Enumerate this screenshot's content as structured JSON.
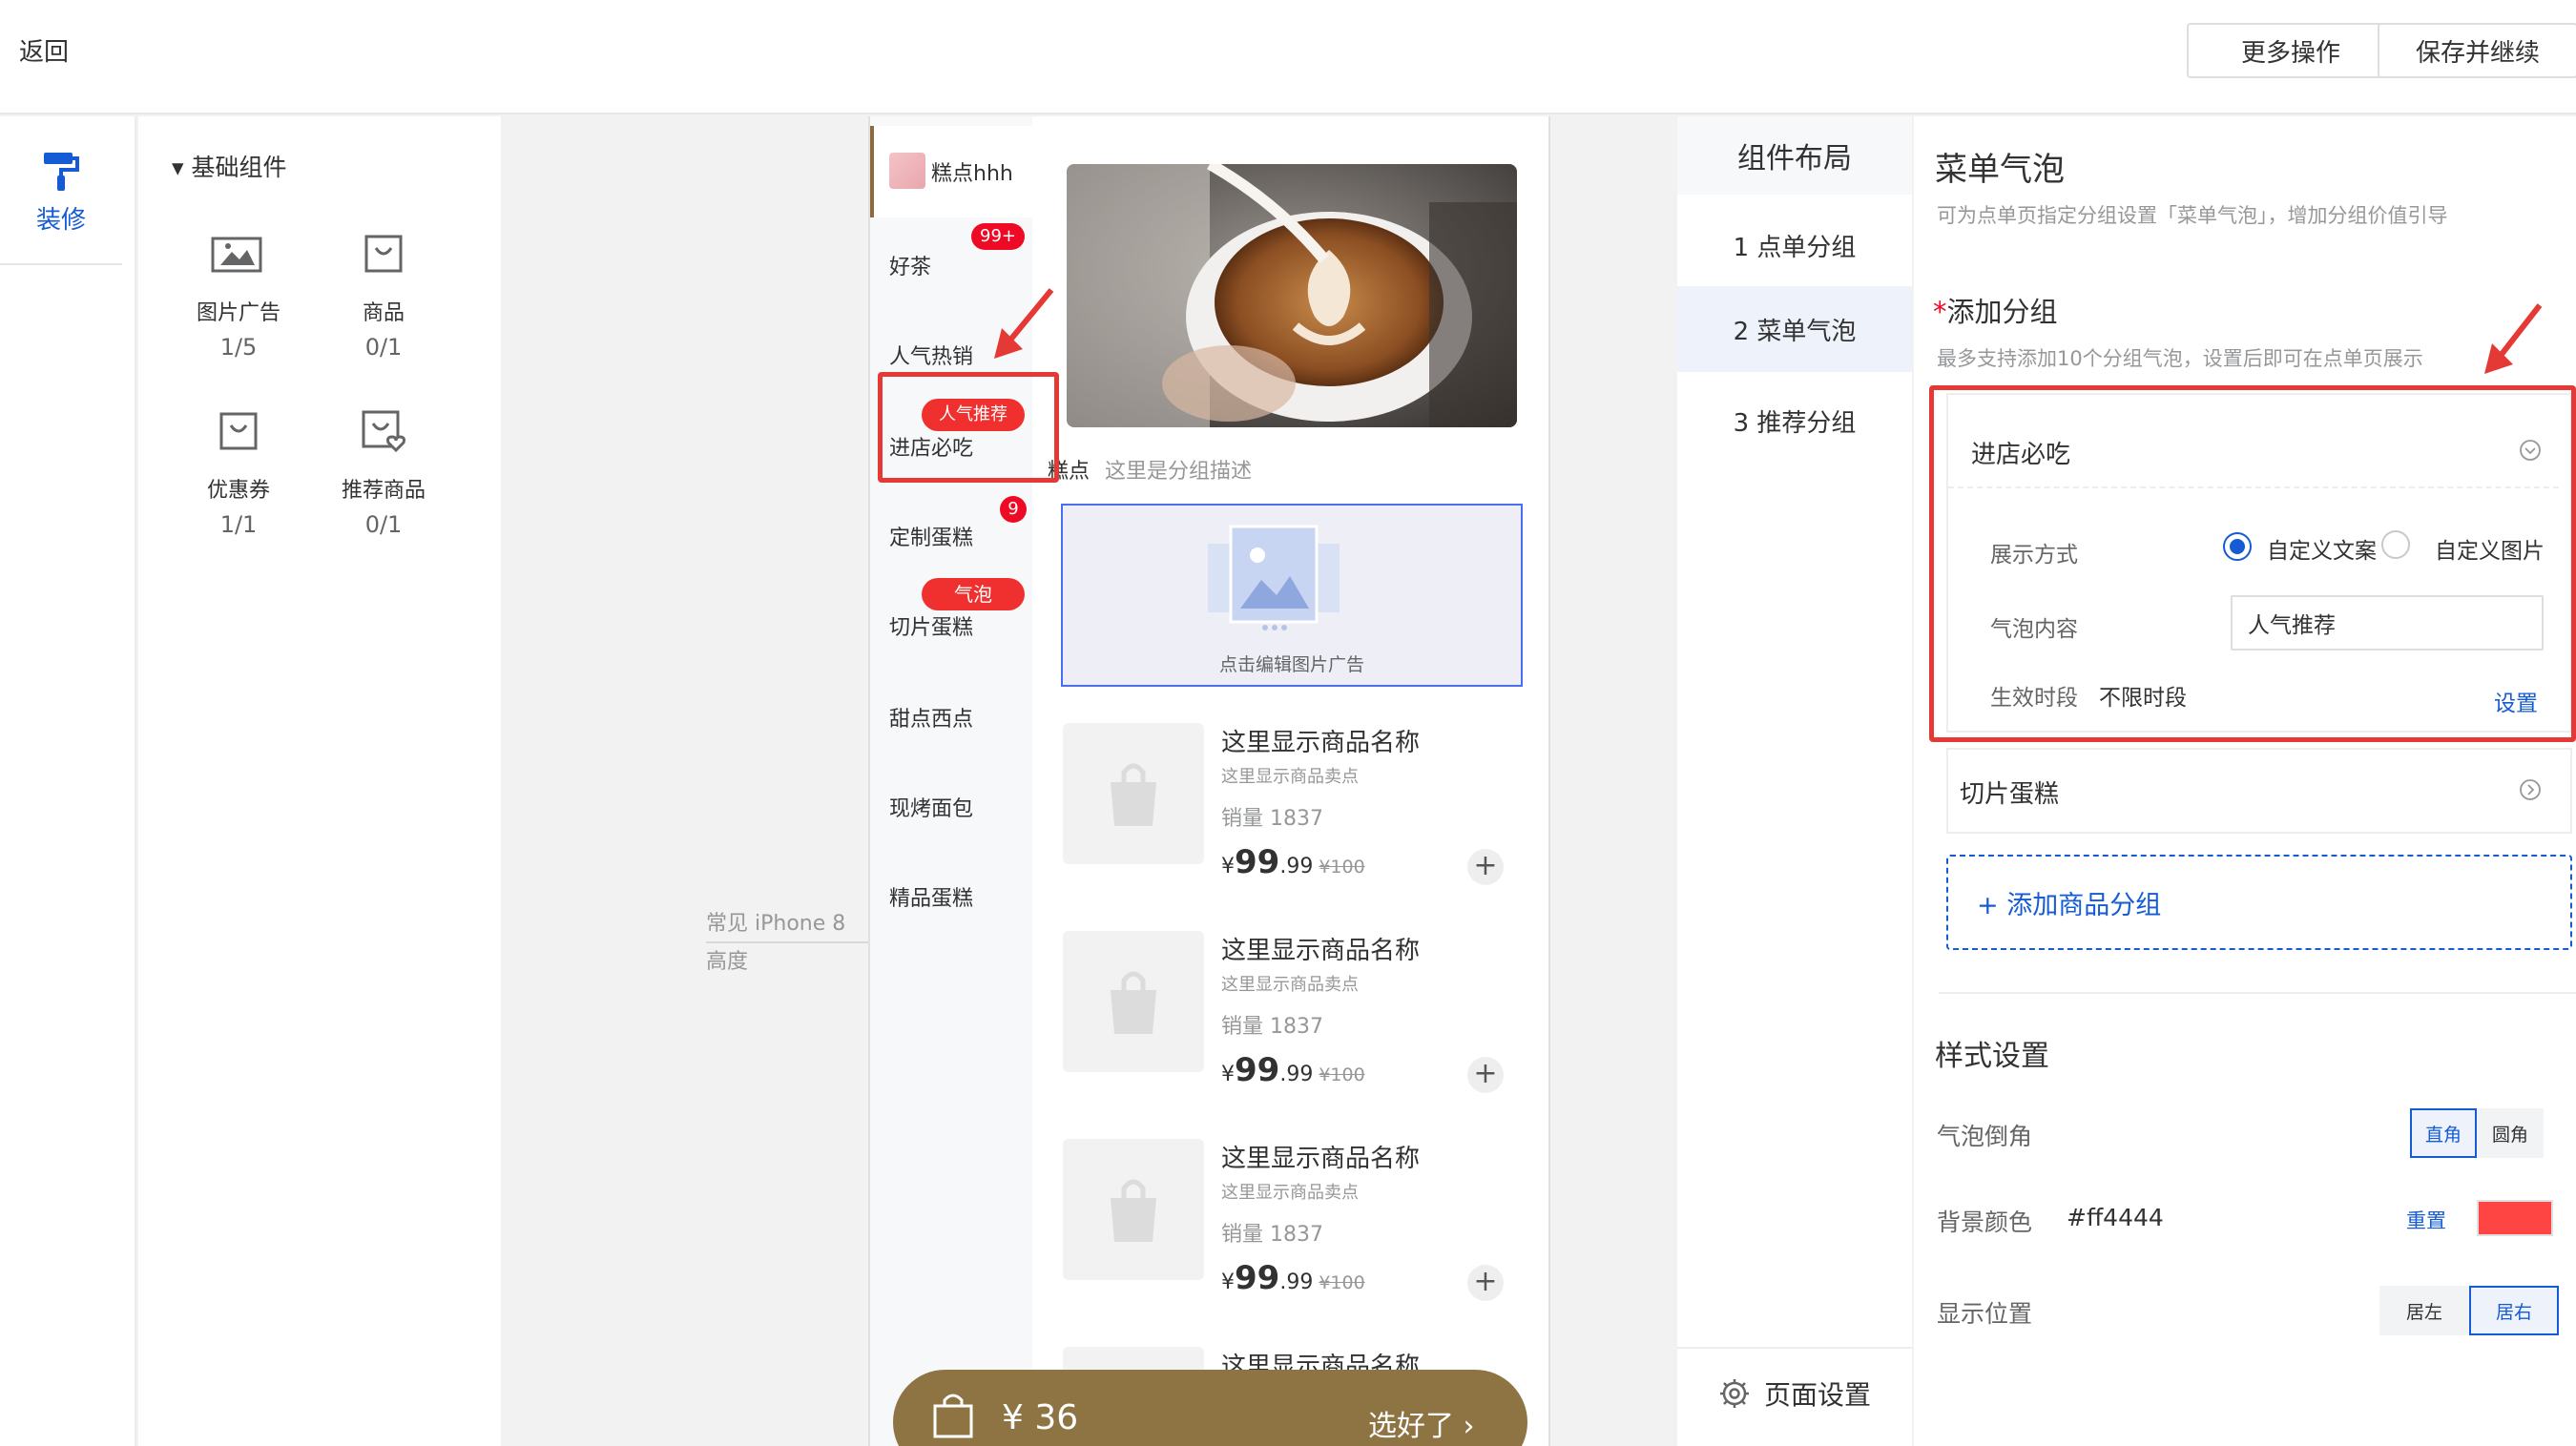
{
  "topbar": {
    "back": "返回",
    "more": "更多操作",
    "save": "保存并继续"
  },
  "rail": {
    "decorate": "装修"
  },
  "components": {
    "group_title": "▾ 基础组件",
    "items": [
      {
        "name": "图片广告",
        "count": "1/5"
      },
      {
        "name": "商品",
        "count": "0/1"
      },
      {
        "name": "优惠券",
        "count": "1/1"
      },
      {
        "name": "推荐商品",
        "count": "0/1"
      }
    ]
  },
  "hint": {
    "line1": "常见 iPhone 8",
    "line2": "高度"
  },
  "preview": {
    "store": "糕点hhh",
    "categories": [
      {
        "label": "好茶",
        "badge": "99+"
      },
      {
        "label": "人气热销"
      },
      {
        "label": "进店必吃",
        "badge": "人气推荐"
      },
      {
        "label": "定制蛋糕",
        "badge": "9"
      },
      {
        "label": "切片蛋糕",
        "badge": "气泡"
      },
      {
        "label": "甜点西点"
      },
      {
        "label": "现烤面包"
      },
      {
        "label": "精品蛋糕"
      }
    ],
    "group_name": "糕点",
    "group_desc": "这里是分组描述",
    "ad_text": "点击编辑图片广告",
    "products": [
      {
        "name": "这里显示商品名称",
        "sub": "这里显示商品卖点",
        "sales": "销量 1837",
        "currency": "¥",
        "price_int": "99",
        "price_dec": ".99",
        "old": "¥100"
      },
      {
        "name": "这里显示商品名称",
        "sub": "这里显示商品卖点",
        "sales": "销量 1837",
        "currency": "¥",
        "price_int": "99",
        "price_dec": ".99",
        "old": "¥100"
      },
      {
        "name": "这里显示商品名称",
        "sub": "这里显示商品卖点",
        "sales": "销量 1837",
        "currency": "¥",
        "price_int": "99",
        "price_dec": ".99",
        "old": "¥100"
      },
      {
        "name": "这里显示商品名称"
      }
    ],
    "cart": {
      "total": "¥ 36",
      "checkout": "选好了 ›"
    }
  },
  "layout": {
    "title": "组件布局",
    "items": [
      "1 点单分组",
      "2 菜单气泡",
      "3 推荐分组"
    ],
    "page_settings": "页面设置"
  },
  "settings": {
    "title": "菜单气泡",
    "desc": "可为点单页指定分组设置「菜单气泡」，增加分组价值引导",
    "add_title": "添加分组",
    "add_star": "*",
    "add_desc": "最多支持添加10个分组气泡，设置后即可在点单页展示",
    "group1": {
      "name": "进店必吃",
      "display_label": "展示方式",
      "option_text": "自定义文案",
      "option_image": "自定义图片",
      "content_label": "气泡内容",
      "content_value": "人气推荐",
      "period_label": "生效时段",
      "period_value": "不限时段",
      "set_link": "设置"
    },
    "group2": {
      "name": "切片蛋糕"
    },
    "add_group": "+ 添加商品分组",
    "style_title": "样式设置",
    "corner_label": "气泡倒角",
    "corner_options": [
      "直角",
      "圆角"
    ],
    "bg_label": "背景颜色",
    "bg_value": "#ff4444",
    "reset": "重置",
    "position_label": "显示位置",
    "position_options": [
      "居左",
      "居右"
    ]
  },
  "colors": {
    "accent": "#155bd4",
    "brand_brown": "#8e7442",
    "badge_red": "#ee0a24",
    "annotation_red": "#e53935"
  }
}
